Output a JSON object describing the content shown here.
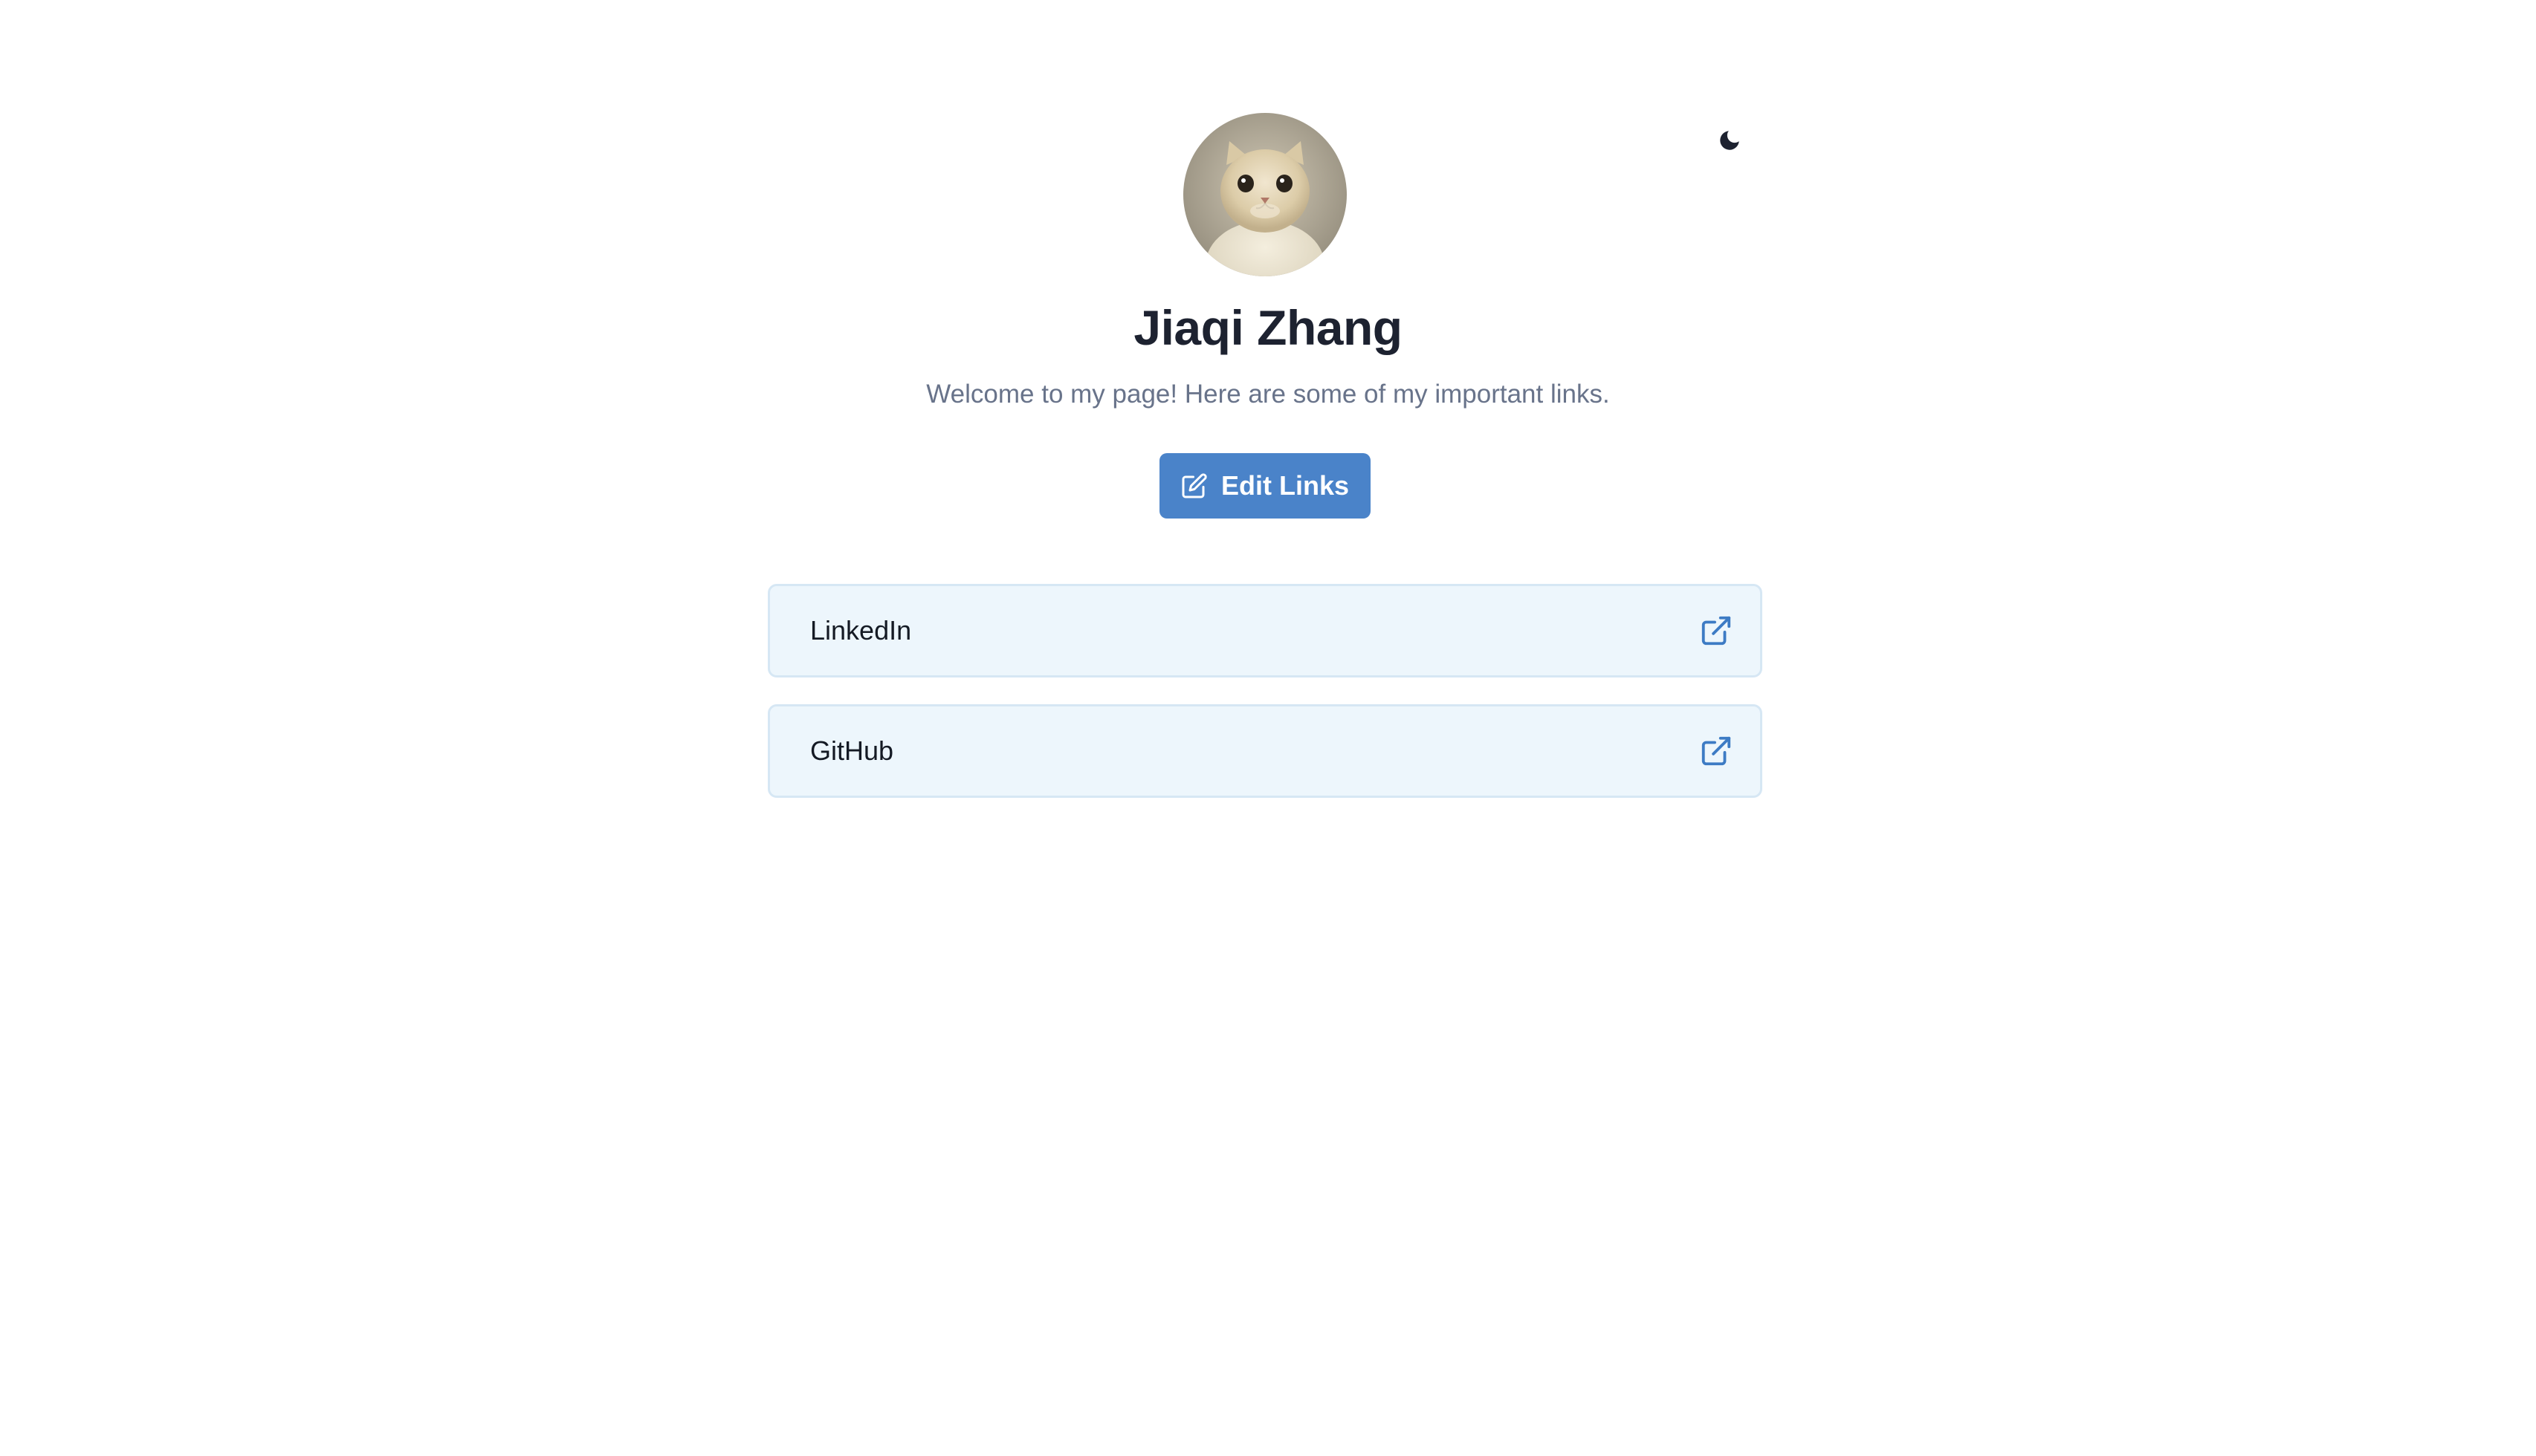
{
  "profile": {
    "name": "Jiaqi Zhang",
    "bio": "Welcome to my page! Here are some of my important links.",
    "avatar": "cat-photo"
  },
  "actions": {
    "edit_label": "Edit Links"
  },
  "links": [
    {
      "label": "LinkedIn",
      "icon": "external-link-icon"
    },
    {
      "label": "GitHub",
      "icon": "external-link-icon"
    }
  ],
  "theme_toggle": {
    "icon": "moon-icon"
  },
  "colors": {
    "primary": "#4a83c9",
    "card_bg": "#edf6fc",
    "card_border": "#d6e7f4",
    "title": "#1d2230",
    "subtitle": "#68738a"
  }
}
